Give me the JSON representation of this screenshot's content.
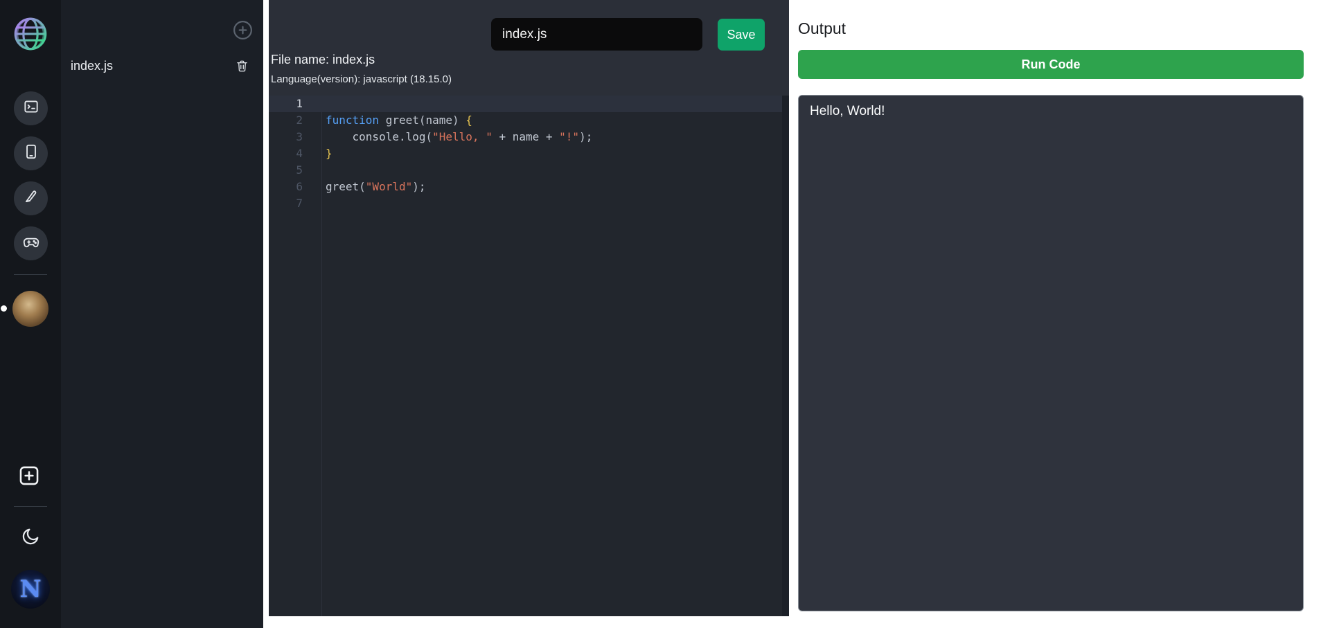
{
  "colors": {
    "save_button": "#0fa369",
    "run_button": "#2ea34d",
    "editor_background": "#22262d",
    "topbar_background": "#2b2f38",
    "sidebar_background": "#14171c",
    "file_panel_background": "#1b1f26",
    "output_box_background": "#2f333d",
    "keyword_token": "#56a0f5",
    "string_token": "#d9745c",
    "brace_token": "#e2c050"
  },
  "sidebar": {
    "icons": [
      "globe-logo",
      "terminal-tool",
      "book-tool",
      "knife-tool",
      "game-controller-tool",
      "book-avatar",
      "add-project",
      "dark-mode-toggle",
      "user-avatar"
    ],
    "user_initial": "N"
  },
  "file_panel": {
    "files": [
      {
        "name": "index.js"
      }
    ]
  },
  "editor": {
    "filename_input": {
      "value": "index.js"
    },
    "save_label": "Save",
    "file_name_label": "File name: index.js",
    "language_label": "Language(version): javascript (18.15.0)",
    "code": {
      "language": "javascript",
      "active_line": 0,
      "lines": [
        [],
        [
          [
            "kw",
            "function"
          ],
          [
            "pl",
            " greet(name) "
          ],
          [
            "br",
            "{"
          ]
        ],
        [
          [
            "pl",
            "    console.log("
          ],
          [
            "str",
            "\"Hello, \""
          ],
          [
            "pl",
            " + name + "
          ],
          [
            "str",
            "\"!\""
          ],
          [
            "pl",
            ");"
          ]
        ],
        [
          [
            "br",
            "}"
          ]
        ],
        [],
        [
          [
            "pl",
            "greet("
          ],
          [
            "str",
            "\"World\""
          ],
          [
            "pl",
            ");"
          ]
        ],
        []
      ]
    }
  },
  "output": {
    "title": "Output",
    "run_label": "Run Code",
    "console_text": "Hello, World!"
  }
}
